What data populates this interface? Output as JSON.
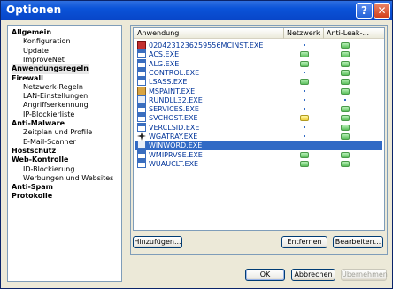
{
  "window": {
    "title": "Optionen"
  },
  "titlebar": {
    "help_label": "?",
    "close_label": "✕"
  },
  "tree": [
    {
      "label": "Allgemein",
      "level": 0
    },
    {
      "label": "Konfiguration",
      "level": 1
    },
    {
      "label": "Update",
      "level": 1
    },
    {
      "label": "ImproveNet",
      "level": 1
    },
    {
      "label": "Anwendungsregeln",
      "level": 0,
      "selected": true
    },
    {
      "label": "Firewall",
      "level": 0
    },
    {
      "label": "Netzwerk-Regeln",
      "level": 1
    },
    {
      "label": "LAN-Einstellungen",
      "level": 1
    },
    {
      "label": "Angriffserkennung",
      "level": 1
    },
    {
      "label": "IP-Blockierliste",
      "level": 1
    },
    {
      "label": "Anti-Malware",
      "level": 0
    },
    {
      "label": "Zeitplan und Profile",
      "level": 1
    },
    {
      "label": "E-Mail-Scanner",
      "level": 1
    },
    {
      "label": "Hostschutz",
      "level": 0
    },
    {
      "label": "Web-Kontrolle",
      "level": 0
    },
    {
      "label": "ID-Blockierung",
      "level": 1
    },
    {
      "label": "Werbungen und Websites",
      "level": 1
    },
    {
      "label": "Anti-Spam",
      "level": 0
    },
    {
      "label": "Protokolle",
      "level": 0
    }
  ],
  "table": {
    "columns": [
      "Anwendung",
      "Netzwerk",
      "Anti-Leak-..."
    ],
    "rows": [
      {
        "name": "0204231236259556MCINST.EXE",
        "icon": "red-m-icon",
        "netzwerk": "dot",
        "antileak": "green"
      },
      {
        "name": "ACS.EXE",
        "icon": "window-icon",
        "netzwerk": "green",
        "antileak": "green"
      },
      {
        "name": "ALG.EXE",
        "icon": "window-icon",
        "netzwerk": "green",
        "antileak": "green"
      },
      {
        "name": "CONTROL.EXE",
        "icon": "window-icon",
        "netzwerk": "dot",
        "antileak": "green"
      },
      {
        "name": "LSASS.EXE",
        "icon": "window-icon",
        "netzwerk": "green",
        "antileak": "green"
      },
      {
        "name": "MSPAINT.EXE",
        "icon": "paint-icon",
        "netzwerk": "dot",
        "antileak": "green"
      },
      {
        "name": "RUNDLL32.EXE",
        "icon": "document-icon",
        "netzwerk": "dot",
        "antileak": "dot"
      },
      {
        "name": "SERVICES.EXE",
        "icon": "window-icon",
        "netzwerk": "dot",
        "antileak": "green"
      },
      {
        "name": "SVCHOST.EXE",
        "icon": "window-icon",
        "netzwerk": "yellow",
        "antileak": "green"
      },
      {
        "name": "VERCLSID.EXE",
        "icon": "window-icon",
        "netzwerk": "dot",
        "antileak": "green"
      },
      {
        "name": "WGATRAY.EXE",
        "icon": "star-icon",
        "netzwerk": "dot",
        "antileak": "green"
      },
      {
        "name": "WINWORD.EXE",
        "icon": "document-icon",
        "netzwerk": "",
        "antileak": "",
        "selected": true
      },
      {
        "name": "WMIPRVSE.EXE",
        "icon": "window-icon",
        "netzwerk": "green",
        "antileak": "green"
      },
      {
        "name": "WUAUCLT.EXE",
        "icon": "window-icon",
        "netzwerk": "green",
        "antileak": "green"
      }
    ]
  },
  "buttons": {
    "add": "Hinzufügen...",
    "remove": "Entfernen",
    "edit": "Bearbeiten...",
    "ok": "OK",
    "cancel": "Abbrechen",
    "apply": "Übernehmen"
  },
  "colors": {
    "selection": "#316ac5",
    "titlebar": "#0a53d8",
    "status_green": "#5cc05c",
    "status_yellow": "#f0d040"
  }
}
